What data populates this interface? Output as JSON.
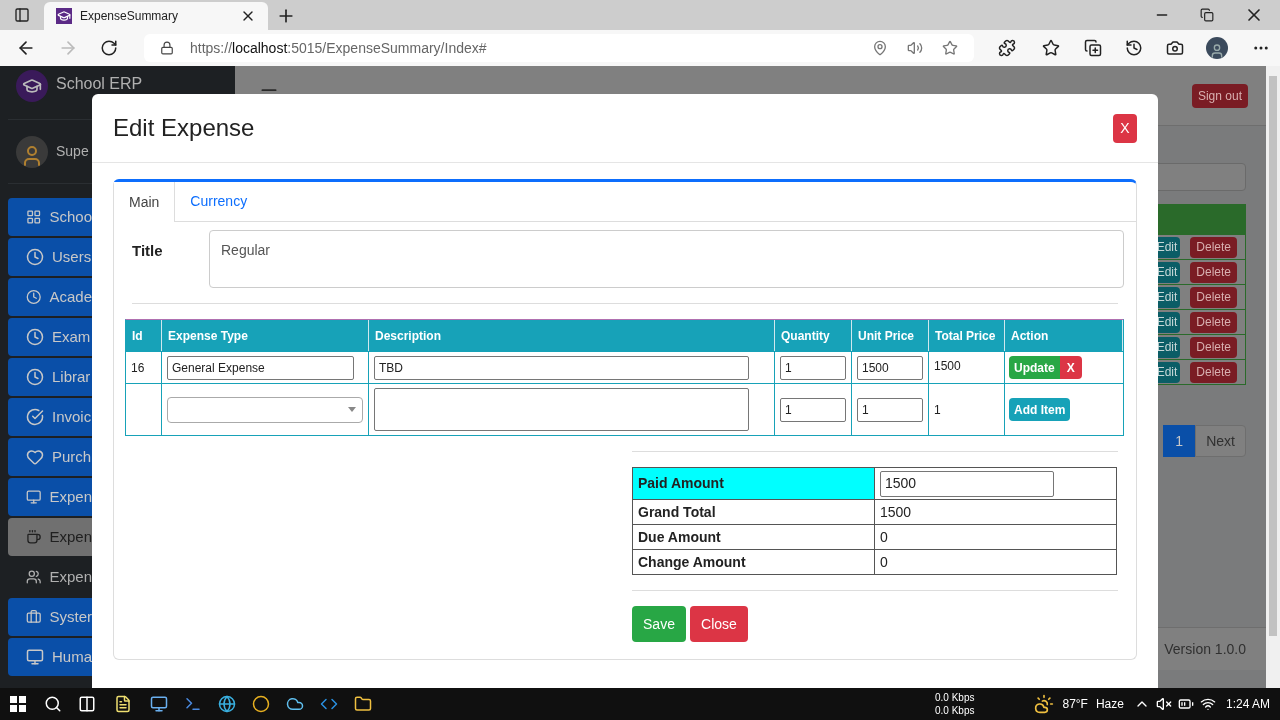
{
  "browser": {
    "tab_title": "ExpenseSummary",
    "url_scheme": "https://",
    "url_host": "localhost",
    "url_path": ":5015/ExpenseSummary/Index#"
  },
  "app": {
    "brand": "School ERP",
    "user": "Supe",
    "sidebar": [
      {
        "label": "Schoo",
        "kind": "button",
        "selected": false
      },
      {
        "label": "Users",
        "kind": "button",
        "selected": false
      },
      {
        "label": "Acade",
        "kind": "button",
        "selected": false
      },
      {
        "label": "Exam",
        "kind": "button",
        "selected": false
      },
      {
        "label": "Librar",
        "kind": "button",
        "selected": false
      },
      {
        "label": "Invoic",
        "kind": "button",
        "selected": false
      },
      {
        "label": "Purch",
        "kind": "button",
        "selected": false
      },
      {
        "label": "Expen",
        "kind": "button",
        "selected": false
      },
      {
        "label": "Expen",
        "kind": "button",
        "selected": true
      },
      {
        "label": "Expen",
        "kind": "link",
        "selected": false
      },
      {
        "label": "Syster",
        "kind": "button",
        "selected": false
      },
      {
        "label": "Huma",
        "kind": "button",
        "selected": false
      }
    ],
    "sign_out": "Sign out",
    "rows": [
      {
        "edit": "Edit",
        "delete": "Delete"
      },
      {
        "edit": "Edit",
        "delete": "Delete"
      },
      {
        "edit": "Edit",
        "delete": "Delete"
      },
      {
        "edit": "Edit",
        "delete": "Delete"
      },
      {
        "edit": "Edit",
        "delete": "Delete"
      },
      {
        "edit": "Edit",
        "delete": "Delete"
      }
    ],
    "pages": [
      {
        "label": "1",
        "selected": true
      }
    ],
    "next": "Next",
    "version": "Version 1.0.0"
  },
  "modal": {
    "title": "Edit Expense",
    "close": "X",
    "tabs": [
      {
        "label": "Main",
        "selected": true
      },
      {
        "label": "Currency",
        "selected": false
      }
    ],
    "title_label": "Title",
    "title_value": "Regular",
    "columns": [
      "Id",
      "Expense Type",
      "Description",
      "Quantity",
      "Unit Price",
      "Total Price",
      "Action"
    ],
    "item": {
      "id": "16",
      "expense_type": "General Expense",
      "description": "TBD",
      "quantity": "1",
      "unit_price": "1500",
      "total_price": "1500",
      "update": "Update",
      "remove": "X"
    },
    "new_item": {
      "quantity": "1",
      "unit_price": "1",
      "total_price": "1",
      "add": "Add Item"
    },
    "summary": [
      {
        "label": "Paid Amount",
        "value": "1500",
        "kind": "input"
      },
      {
        "label": "Grand Total",
        "value": "1500",
        "kind": "text"
      },
      {
        "label": "Due Amount",
        "value": "0",
        "kind": "text"
      },
      {
        "label": "Change Amount",
        "value": "0",
        "kind": "text"
      }
    ],
    "save": "Save",
    "cancel": "Close"
  },
  "taskbar": {
    "upload": "0.0 Kbps",
    "download": "0.0 Kbps",
    "temperature": "87°F",
    "weather": "Haze",
    "time": "1:24 AM"
  }
}
